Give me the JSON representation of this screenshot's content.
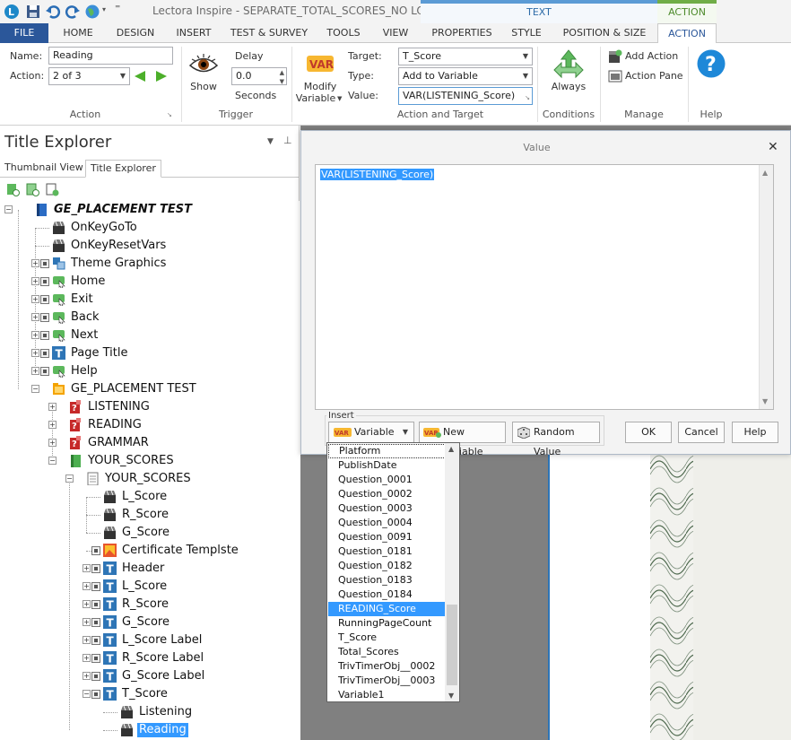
{
  "window": {
    "title": "Lectora Inspire - SEPARATE_TOTAL_SCORES_NO LOGIN"
  },
  "context_tabs": {
    "text": "TEXT",
    "action": "ACTION"
  },
  "tabs": [
    "FILE",
    "HOME",
    "DESIGN",
    "INSERT",
    "TEST & SURVEY",
    "TOOLS",
    "VIEW",
    "PROPERTIES",
    "STYLE",
    "POSITION & SIZE",
    "ACTION"
  ],
  "active_tab": "ACTION",
  "colors": {
    "file_tab": "#2b579a",
    "text_context": "#5b9bd5",
    "action_context": "#70ad47",
    "selection": "#3399ff"
  },
  "ribbon": {
    "action_group": {
      "name_label": "Name:",
      "name_value": "Reading",
      "action_label": "Action:",
      "action_value": "2 of 3",
      "group_label": "Action"
    },
    "trigger_group": {
      "show_label": "Show",
      "delay_label": "Delay",
      "delay_value": "0.0",
      "seconds_label": "Seconds",
      "group_label": "Trigger"
    },
    "action_target_group": {
      "modify_label": "Modify",
      "variable_label": "Variable",
      "target_label": "Target:",
      "target_value": "T_Score",
      "type_label": "Type:",
      "type_value": "Add to Variable",
      "value_label": "Value:",
      "value_value": "VAR(LISTENING_Score)",
      "group_label": "Action and Target"
    },
    "conditions_group": {
      "always_label": "Always",
      "group_label": "Conditions"
    },
    "manage_group": {
      "add_action": "Add Action",
      "action_pane": "Action Pane",
      "group_label": "Manage"
    },
    "help_group": {
      "group_label": "Help"
    }
  },
  "panel": {
    "title": "Title Explorer",
    "tabs": [
      "Thumbnail View",
      "Title Explorer"
    ],
    "tree": [
      {
        "label": "GE_PLACEMENT TEST",
        "icon": "book-icon"
      },
      {
        "label": "OnKeyGoTo",
        "icon": "action-icon"
      },
      {
        "label": "OnKeyResetVars",
        "icon": "action-icon"
      },
      {
        "label": "Theme Graphics",
        "icon": "group-icon"
      },
      {
        "label": "Home",
        "icon": "button-icon"
      },
      {
        "label": "Exit",
        "icon": "button-icon"
      },
      {
        "label": "Back",
        "icon": "button-icon"
      },
      {
        "label": "Next",
        "icon": "button-icon"
      },
      {
        "label": "Page Title",
        "icon": "text-icon"
      },
      {
        "label": "Help",
        "icon": "button-icon"
      },
      {
        "label": "GE_PLACEMENT TEST",
        "icon": "folder-icon"
      },
      {
        "label": "LISTENING",
        "icon": "test-icon"
      },
      {
        "label": "READING",
        "icon": "test-icon"
      },
      {
        "label": "GRAMMAR",
        "icon": "test-icon"
      },
      {
        "label": "YOUR_SCORES",
        "icon": "chapter-icon"
      },
      {
        "label": "YOUR_SCORES",
        "icon": "page-icon"
      },
      {
        "label": "L_Score",
        "icon": "action-icon"
      },
      {
        "label": "R_Score",
        "icon": "action-icon"
      },
      {
        "label": "G_Score",
        "icon": "action-icon"
      },
      {
        "label": "Certificate Templste",
        "icon": "image-icon"
      },
      {
        "label": "Header",
        "icon": "text-icon"
      },
      {
        "label": "L_Score",
        "icon": "text-icon"
      },
      {
        "label": "R_Score",
        "icon": "text-icon"
      },
      {
        "label": "G_Score",
        "icon": "text-icon"
      },
      {
        "label": "L_Score Label",
        "icon": "text-icon"
      },
      {
        "label": "R_Score Label",
        "icon": "text-icon"
      },
      {
        "label": "G_Score Label",
        "icon": "text-icon"
      },
      {
        "label": "T_Score",
        "icon": "text-icon"
      },
      {
        "label": "Listening",
        "icon": "action-icon"
      },
      {
        "label": "Reading",
        "icon": "action-icon"
      }
    ]
  },
  "dialog": {
    "title": "Value",
    "value_text": "VAR(LISTENING_Score)",
    "insert_label": "Insert",
    "variable_combo": "Variable",
    "new_variable": "New Variable",
    "random_value": "Random Value",
    "ok": "OK",
    "cancel": "Cancel",
    "help": "Help"
  },
  "variable_list": {
    "items": [
      "Platform",
      "PublishDate",
      "Question_0001",
      "Question_0002",
      "Question_0003",
      "Question_0004",
      "Question_0091",
      "Question_0181",
      "Question_0182",
      "Question_0183",
      "Question_0184",
      "READING_Score",
      "RunningPageCount",
      "T_Score",
      "Total_Scores",
      "TrivTimerObj__0002",
      "TrivTimerObj__0003",
      "Variable1"
    ],
    "highlighted": "READING_Score"
  }
}
